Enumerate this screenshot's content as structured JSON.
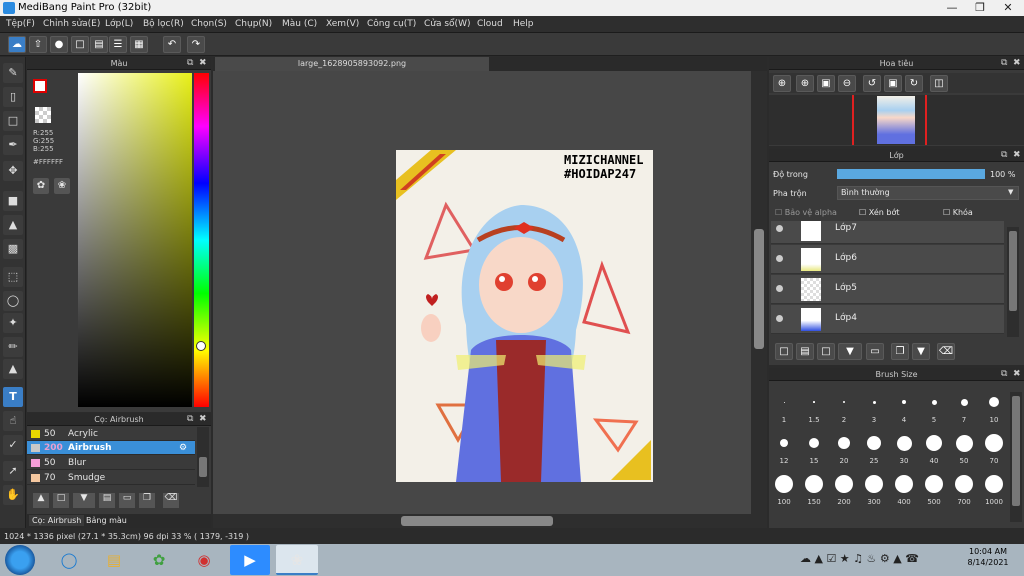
{
  "window": {
    "title": "MediBang Paint Pro (32bit)"
  },
  "menu": [
    "Tệp(F)",
    "Chỉnh sửa(E)",
    "Lớp(L)",
    "Bộ lọc(R)",
    "Chọn(S)",
    "Chụp(N)",
    "Màu (C)",
    "Xem(V)",
    "Công cụ(T)",
    "Cửa sổ(W)",
    "Cloud",
    "Help"
  ],
  "color_panel": {
    "title": "Màu",
    "r": "R:255",
    "g": "G:255",
    "b": "B:255",
    "hex": "#FFFFFF"
  },
  "brush_panel": {
    "title": "Cọ: Airbrush",
    "items": [
      {
        "size": "50",
        "name": "Acrylic",
        "color": "#e8d800"
      },
      {
        "size": "200",
        "name": "Airbrush",
        "color": "#c8c8c8"
      },
      {
        "size": "50",
        "name": "Blur",
        "color": "#f59ed8"
      },
      {
        "size": "70",
        "name": "Smudge",
        "color": "#f5c8a0"
      }
    ]
  },
  "left_tabs": {
    "brush": "Cọ: Airbrush",
    "palette": "Bảng màu"
  },
  "document": {
    "tab": "large_1628905893092.png",
    "watermark1": "MIZICHANNEL",
    "watermark2": "#HOIDAP247"
  },
  "navigator": {
    "title": "Hoa tiêu"
  },
  "layer_panel": {
    "title": "Lớp",
    "opacity_label": "Độ trong",
    "opacity_value": "100 %",
    "opacity_fraction": 1.0,
    "blend_label": "Pha trộn",
    "blend_value": "Bình thường",
    "protect_alpha": "Bảo vệ alpha",
    "clip": "Xén bớt",
    "lock": "Khóa",
    "layers": [
      "Lớp7",
      "Lớp6",
      "Lớp5",
      "Lớp4"
    ]
  },
  "brush_size": {
    "title": "Brush Size",
    "sizes": [
      "1",
      "1.5",
      "2",
      "3",
      "4",
      "5",
      "7",
      "10",
      "12",
      "15",
      "20",
      "25",
      "30",
      "40",
      "50",
      "70",
      "100",
      "150",
      "200",
      "300",
      "400",
      "500",
      "700",
      "1000"
    ]
  },
  "status": {
    "text": "1024 * 1336 pixel   (27.1 * 35.3cm)   96 dpi   33 %   ( 1379, -319 )"
  },
  "clock": {
    "time": "10:04 AM",
    "date": "8/14/2021"
  }
}
